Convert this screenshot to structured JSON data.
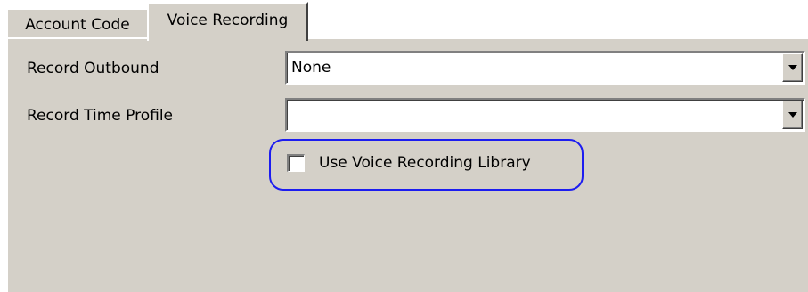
{
  "tabs": [
    {
      "label": "Account Code",
      "active": false
    },
    {
      "label": "Voice Recording",
      "active": true
    }
  ],
  "form": {
    "record_outbound": {
      "label": "Record Outbound",
      "value": "None"
    },
    "record_time_profile": {
      "label": "Record Time Profile",
      "value": ""
    },
    "use_library": {
      "label": "Use Voice Recording Library",
      "checked": false
    }
  },
  "colors": {
    "panel_bg": "#d4d0c8",
    "highlight_ring": "#1c1cf0"
  },
  "icons": {
    "combo_arrow": "chevron-down-icon"
  }
}
